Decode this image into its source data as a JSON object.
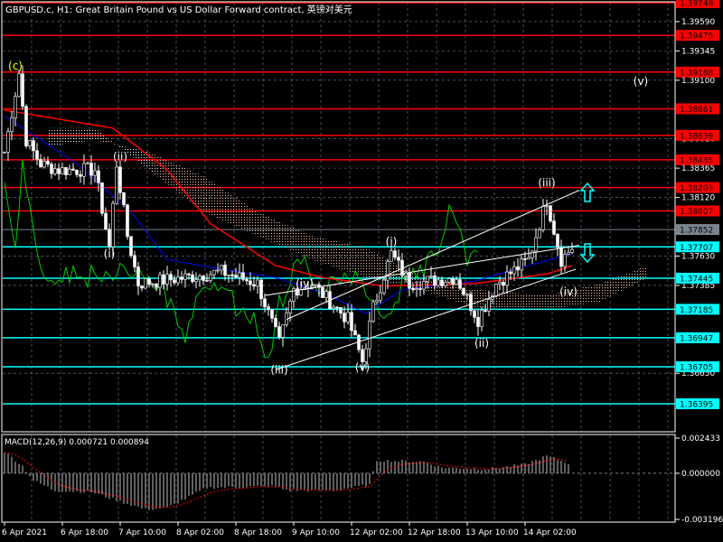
{
  "header": {
    "title": "GBPUSD.c, H1:  Great Britain Pound vs US Dollar Forward contract, 英镑对美元"
  },
  "colors": {
    "background": "#000000",
    "grid": "#708090",
    "resistance": "#ff0000",
    "support": "#00ffff",
    "current": "#7a8591",
    "price": "#ffffff",
    "ma_red": "#ff0000",
    "ma_blue": "#0000ff",
    "lagging": "#00cc00",
    "cloud_a": "#ffbfa0",
    "cloud_b": "#ffffff"
  },
  "chart_data": [
    {
      "type": "line",
      "title": "GBPUSD.c, H1",
      "ylim": [
        1.36395,
        1.39748
      ],
      "axis_ticks": [
        "1.39590",
        "1.39345",
        "1.39100",
        "1.38610",
        "1.38365",
        "1.38120",
        "1.37630",
        "1.37385",
        "1.36650"
      ],
      "x_labels": [
        "6 Apr 2021",
        "6 Apr 18:00",
        "7 Apr 10:00",
        "8 Apr 02:00",
        "8 Apr 18:00",
        "9 Apr 10:00",
        "12 Apr 02:00",
        "12 Apr 18:00",
        "13 Apr 10:00",
        "14 Apr 02:00"
      ],
      "bars_per_label": 16,
      "price_path": [
        [
          0,
          1.385
        ],
        [
          4,
          1.3916
        ],
        [
          6,
          1.386
        ],
        [
          10,
          1.384
        ],
        [
          15,
          1.3835
        ],
        [
          25,
          1.3835
        ],
        [
          29,
          1.377
        ],
        [
          31,
          1.384
        ],
        [
          34,
          1.378
        ],
        [
          37,
          1.374
        ],
        [
          50,
          1.3745
        ],
        [
          60,
          1.375
        ],
        [
          70,
          1.374
        ],
        [
          76,
          1.369
        ],
        [
          80,
          1.3735
        ],
        [
          85,
          1.374
        ],
        [
          95,
          1.371
        ],
        [
          99,
          1.3675
        ],
        [
          102,
          1.372
        ],
        [
          107,
          1.3765
        ],
        [
          112,
          1.374
        ],
        [
          125,
          1.3745
        ],
        [
          131,
          1.371
        ],
        [
          136,
          1.374
        ],
        [
          145,
          1.376
        ],
        [
          150,
          1.381
        ],
        [
          154,
          1.376
        ],
        [
          157,
          1.377
        ]
      ],
      "ma_red": [
        [
          0,
          1.3885
        ],
        [
          30,
          1.387
        ],
        [
          45,
          1.3835
        ],
        [
          57,
          1.379
        ],
        [
          75,
          1.3755
        ],
        [
          88,
          1.3745
        ],
        [
          105,
          1.3738
        ],
        [
          130,
          1.374
        ],
        [
          150,
          1.3748
        ],
        [
          157,
          1.3755
        ]
      ],
      "ma_blue": [
        [
          0,
          1.388
        ],
        [
          20,
          1.384
        ],
        [
          35,
          1.38
        ],
        [
          45,
          1.376
        ],
        [
          60,
          1.3752
        ],
        [
          75,
          1.3745
        ],
        [
          90,
          1.373
        ],
        [
          100,
          1.3715
        ],
        [
          110,
          1.3735
        ],
        [
          130,
          1.3742
        ],
        [
          145,
          1.3755
        ],
        [
          157,
          1.3765
        ]
      ],
      "cloud": [
        [
          12,
          1.3855,
          1.387
        ],
        [
          25,
          1.386,
          1.387
        ],
        [
          40,
          1.385,
          1.3835
        ],
        [
          55,
          1.383,
          1.38
        ],
        [
          70,
          1.38,
          1.378
        ],
        [
          85,
          1.378,
          1.376
        ],
        [
          100,
          1.377,
          1.3745
        ],
        [
          115,
          1.3745,
          1.3735
        ],
        [
          130,
          1.3735,
          1.372
        ],
        [
          150,
          1.373,
          1.3718
        ],
        [
          165,
          1.374,
          1.3725
        ],
        [
          178,
          1.3755,
          1.3745
        ]
      ],
      "horizontal_levels": [
        {
          "price": "1.39748",
          "kind": "resistance"
        },
        {
          "price": "1.39475",
          "kind": "resistance"
        },
        {
          "price": "1.39168",
          "kind": "resistance"
        },
        {
          "price": "1.38861",
          "kind": "resistance"
        },
        {
          "price": "1.38639",
          "kind": "resistance"
        },
        {
          "price": "1.38435",
          "kind": "resistance"
        },
        {
          "price": "1.38203",
          "kind": "resistance"
        },
        {
          "price": "1.38007",
          "kind": "resistance"
        },
        {
          "price": "1.37707",
          "kind": "support"
        },
        {
          "price": "1.37445",
          "kind": "support"
        },
        {
          "price": "1.37185",
          "kind": "support"
        },
        {
          "price": "1.36947",
          "kind": "support"
        },
        {
          "price": "1.36705",
          "kind": "support"
        },
        {
          "price": "1.36395",
          "kind": "support"
        }
      ],
      "current_price": "1.37852",
      "wave_labels": [
        {
          "text": "(c)",
          "bar": 3,
          "price": 1.3922,
          "color": "#ffff00"
        },
        {
          "text": "(ii)",
          "bar": 32,
          "price": 1.3846,
          "color": "#ffffff"
        },
        {
          "text": "(i)",
          "bar": 29,
          "price": 1.3765,
          "color": "#ffffff"
        },
        {
          "text": "(iii)",
          "bar": 76,
          "price": 1.3668,
          "color": "#ffffff"
        },
        {
          "text": "(iv)",
          "bar": 83,
          "price": 1.374,
          "color": "#ffffff"
        },
        {
          "text": "(v)",
          "bar": 99,
          "price": 1.367,
          "color": "#ffffff"
        },
        {
          "text": "(i)",
          "bar": 107,
          "price": 1.3775,
          "color": "#ffffff"
        },
        {
          "text": "(ii)",
          "bar": 132,
          "price": 1.369,
          "color": "#ffffff"
        },
        {
          "text": "(iii)",
          "bar": 150,
          "price": 1.3824,
          "color": "#ffffff"
        },
        {
          "text": "(iv)",
          "bar": 156,
          "price": 1.3733,
          "color": "#ffffff"
        },
        {
          "text": "(v)",
          "bar": 176,
          "price": 1.3909,
          "color": "#ffffff"
        }
      ],
      "channel": [
        {
          "from": [
            75,
            1.3668
          ],
          "to": [
            158,
            1.3752
          ]
        },
        {
          "from": [
            78,
            1.371
          ],
          "to": [
            159,
            1.3818
          ]
        },
        {
          "from": [
            72,
            1.373
          ],
          "to": [
            159,
            1.3772
          ]
        }
      ]
    },
    {
      "type": "bar",
      "title": "MACD(12,26,9) 0.000721 0.000894",
      "ylim": [
        -0.003196,
        0.002433
      ],
      "tick_labels": [
        "0.002433",
        "0.000000",
        "-0.003196"
      ],
      "main_path": [
        [
          0,
          0.0015
        ],
        [
          5,
          0.0005
        ],
        [
          8,
          -0.0005
        ],
        [
          14,
          -0.0012
        ],
        [
          24,
          -0.0013
        ],
        [
          39,
          -0.0025
        ],
        [
          45,
          -0.0024
        ],
        [
          56,
          -0.001
        ],
        [
          74,
          -0.0009
        ],
        [
          79,
          -0.0012
        ],
        [
          91,
          -0.0012
        ],
        [
          101,
          -0.0008
        ],
        [
          103,
          0.0009
        ],
        [
          116,
          0.0008
        ],
        [
          121,
          0.0004
        ],
        [
          134,
          0.0003
        ],
        [
          144,
          0.0006
        ],
        [
          150,
          0.0012
        ],
        [
          156,
          0.0007
        ]
      ],
      "signal_period": 9
    }
  ],
  "arrows": [
    {
      "dir": "up",
      "icon": "arrow-up-icon"
    },
    {
      "dir": "down",
      "icon": "arrow-down-icon"
    }
  ]
}
